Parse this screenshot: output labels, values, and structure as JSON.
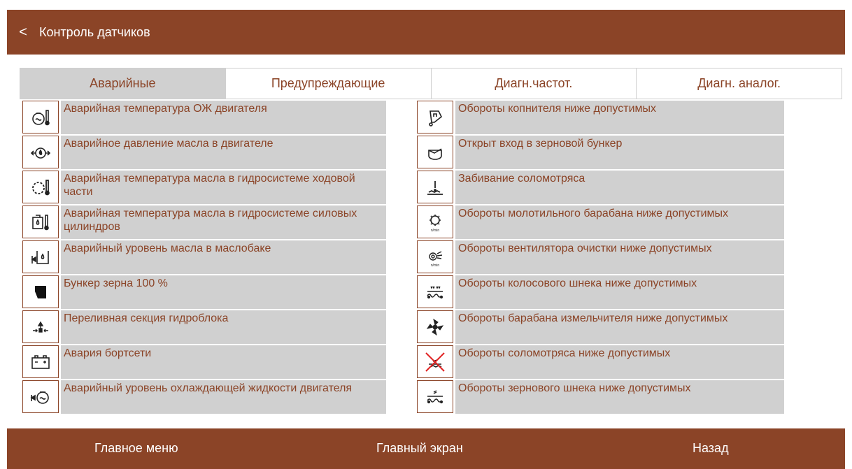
{
  "header": {
    "back_label": "<",
    "title": "Контроль датчиков"
  },
  "tabs": [
    {
      "label": "Аварийные",
      "active": true
    },
    {
      "label": "Предупреждающие",
      "active": false
    },
    {
      "label": "Диагн.частот.",
      "active": false
    },
    {
      "label": "Диагн. аналог.",
      "active": false
    }
  ],
  "left_items": [
    {
      "icon": "engine-coolant-temp-icon",
      "text": "Аварийная температура ОЖ двигателя"
    },
    {
      "icon": "engine-oil-pressure-icon",
      "text": "Аварийное давление масла в двигателе"
    },
    {
      "icon": "chassis-hydraulic-oil-temp-icon",
      "text": "Аварийная температура масла в гидросистеме ходовой части"
    },
    {
      "icon": "power-cylinder-oil-temp-icon",
      "text": "Аварийная температура масла в гидросистеме силовых цилиндров"
    },
    {
      "icon": "oil-tank-level-icon",
      "text": "Аварийный уровень масла в маслобаке"
    },
    {
      "icon": "grain-bunker-full-icon",
      "text": "Бункер зерна 100 %"
    },
    {
      "icon": "overflow-section-icon",
      "text": "Переливная секция гидроблока"
    },
    {
      "icon": "battery-icon",
      "text": "Авария бортсети"
    },
    {
      "icon": "coolant-level-icon",
      "text": "Аварийный уровень охлаждающей жидкости двигателя"
    }
  ],
  "right_items": [
    {
      "icon": "copier-speed-icon",
      "text": "Обороты копнителя ниже допустимых"
    },
    {
      "icon": "grain-bunker-entry-icon",
      "text": "Открыт вход в зерновой бункер"
    },
    {
      "icon": "straw-walker-clog-icon",
      "text": "Забивание соломотряса"
    },
    {
      "icon": "threshing-drum-speed-icon",
      "text": "Обороты молотильного барабана ниже допустимых",
      "unit": "n/min"
    },
    {
      "icon": "cleaning-fan-speed-icon",
      "text": "Обороты вентилятора очистки ниже допустимых",
      "unit": "n/min"
    },
    {
      "icon": "tailings-auger-speed-icon",
      "text": "Обороты колосового шнека ниже допустимых"
    },
    {
      "icon": "chopper-drum-speed-icon",
      "text": "Обороты барабана измельчителя ниже допустимых"
    },
    {
      "icon": "straw-walker-speed-disabled-icon",
      "text": "Обороты соломотряса ниже допустимых"
    },
    {
      "icon": "grain-auger-speed-icon",
      "text": "Обороты зернового шнека ниже допустимых"
    }
  ],
  "footer": {
    "main_menu": "Главное меню",
    "main_screen": "Главный экран",
    "back": "Назад"
  },
  "colors": {
    "brand": "#8b4427",
    "row_bg": "#d0d0d0",
    "active_tab": "#d0d0d0",
    "cross": "#e02020"
  }
}
